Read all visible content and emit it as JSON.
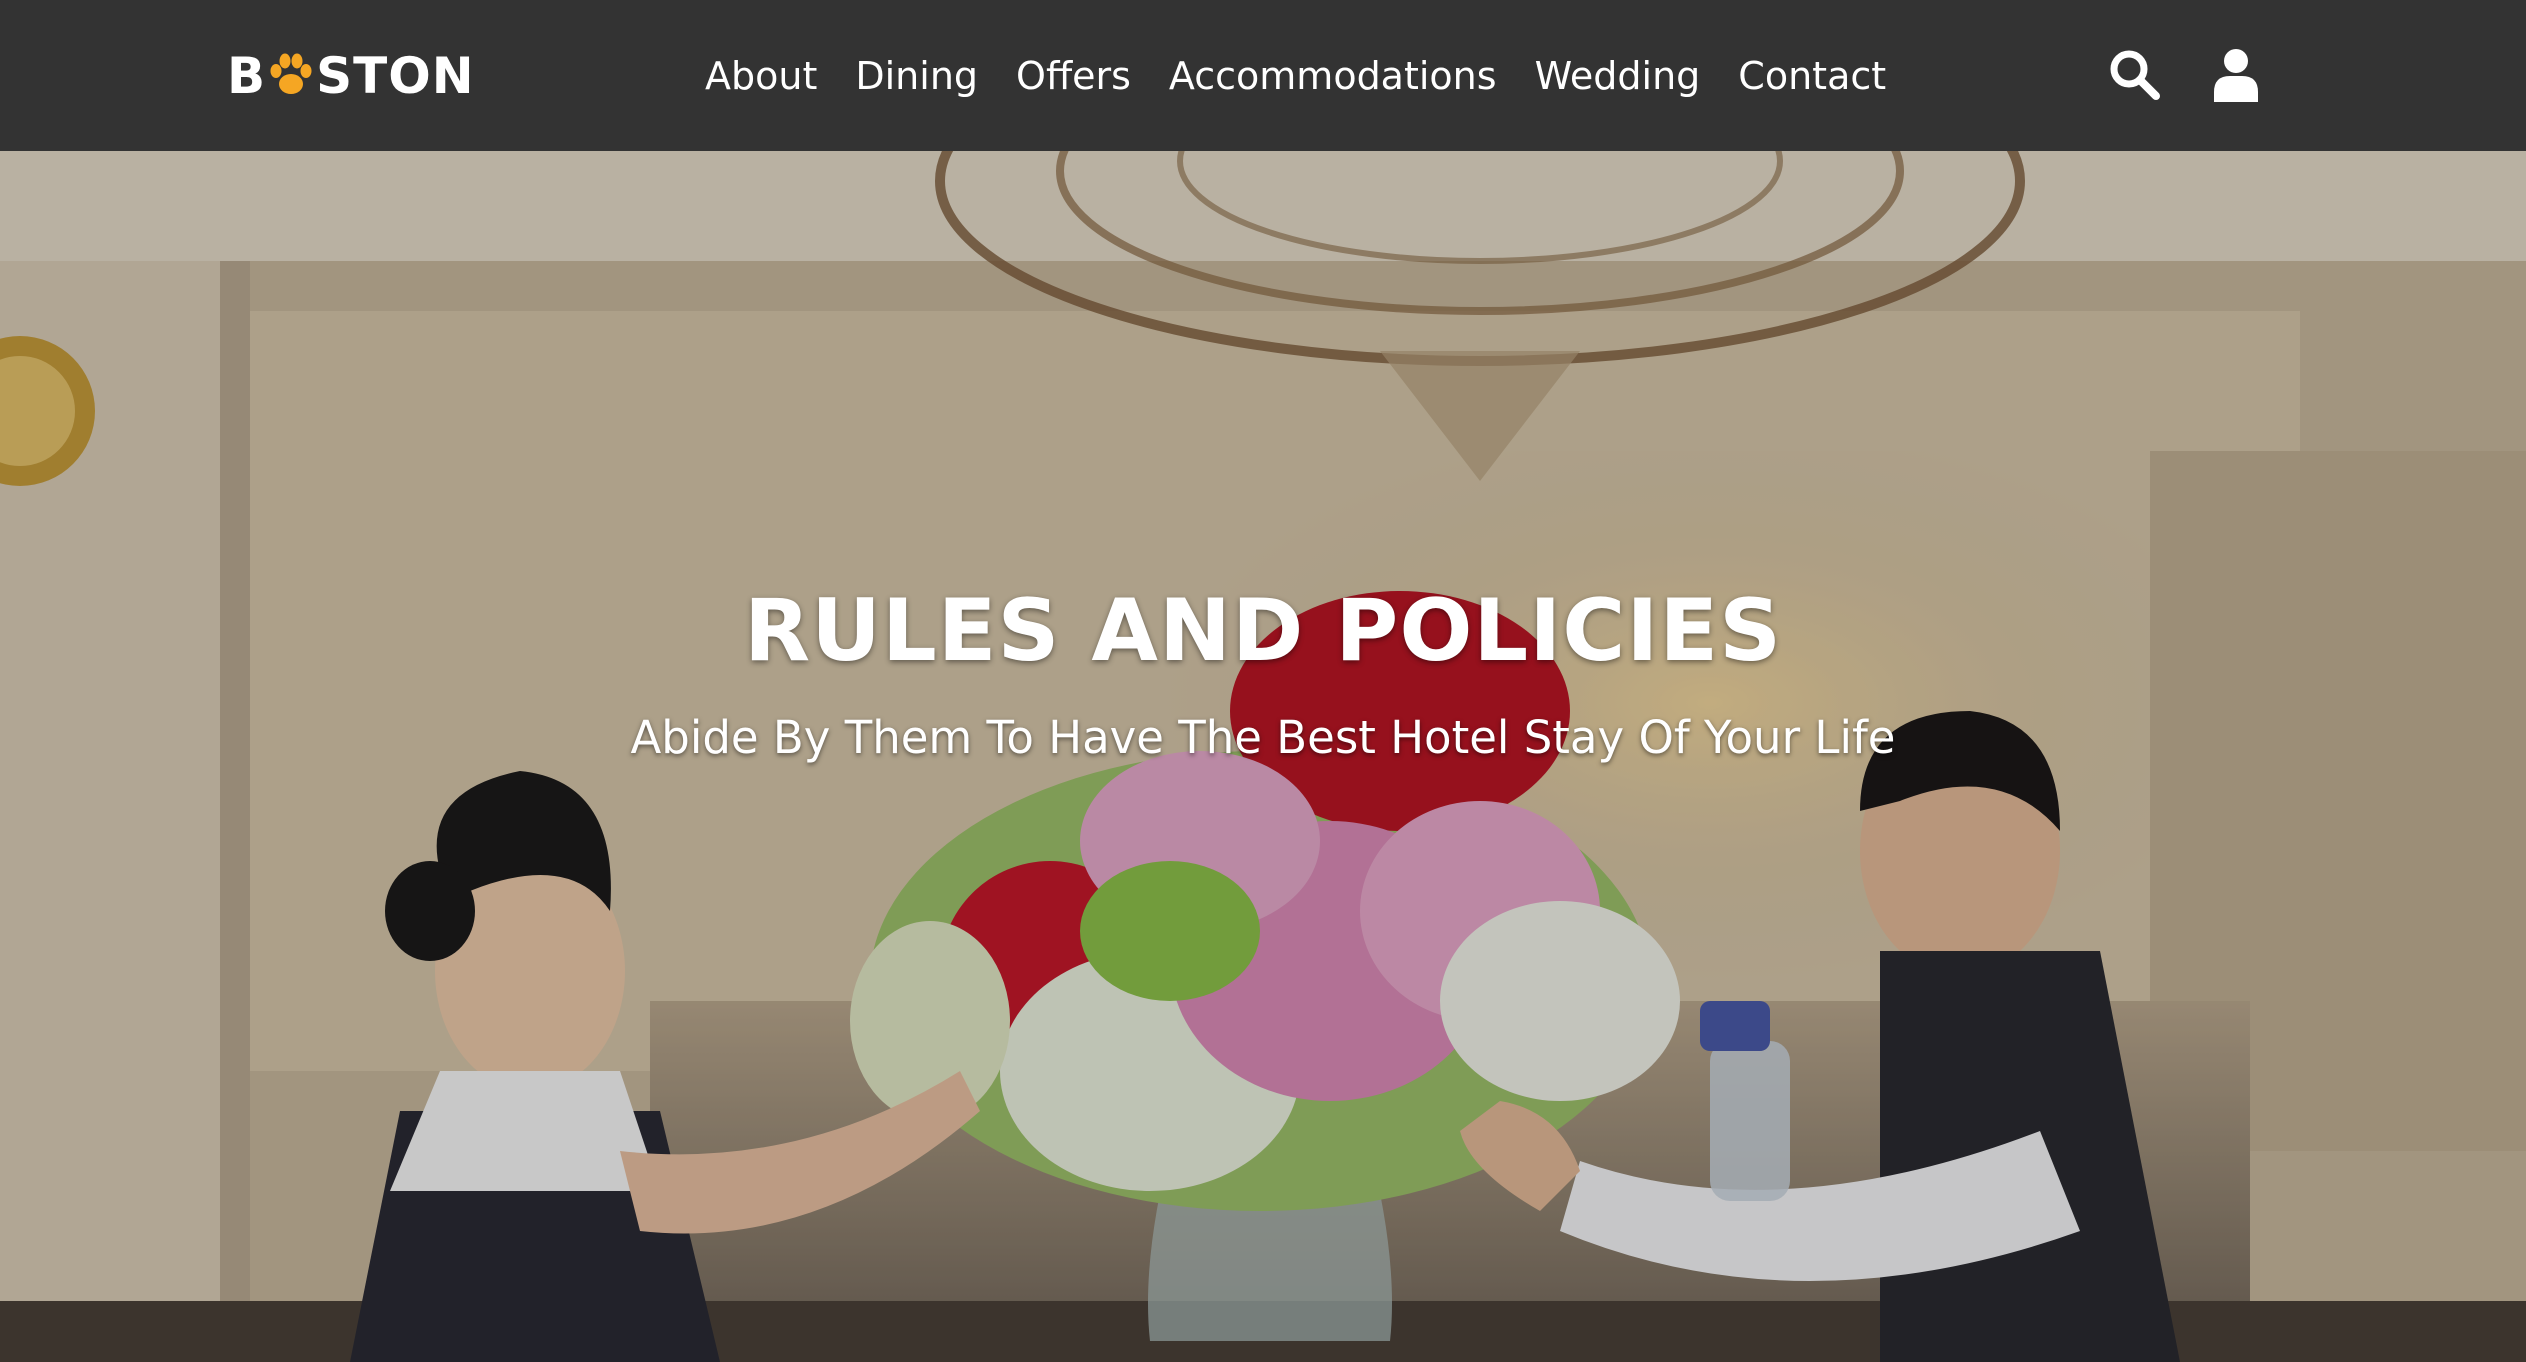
{
  "brand": {
    "logo_prefix": "B",
    "logo_suffix": "STON",
    "paw_color": "#f5a623"
  },
  "nav": {
    "items": [
      {
        "label": "About"
      },
      {
        "label": "Dining"
      },
      {
        "label": "Offers"
      },
      {
        "label": "Accommodations"
      },
      {
        "label": "Wedding"
      },
      {
        "label": "Contact"
      }
    ],
    "icons": [
      "search-icon",
      "user-icon"
    ]
  },
  "hero": {
    "title": "RULES AND POLICIES",
    "subtitle": "Abide By Them To Have The Best Hotel Stay Of Your Life"
  },
  "colors": {
    "navbar_bg": "#333333",
    "text": "#ffffff"
  }
}
